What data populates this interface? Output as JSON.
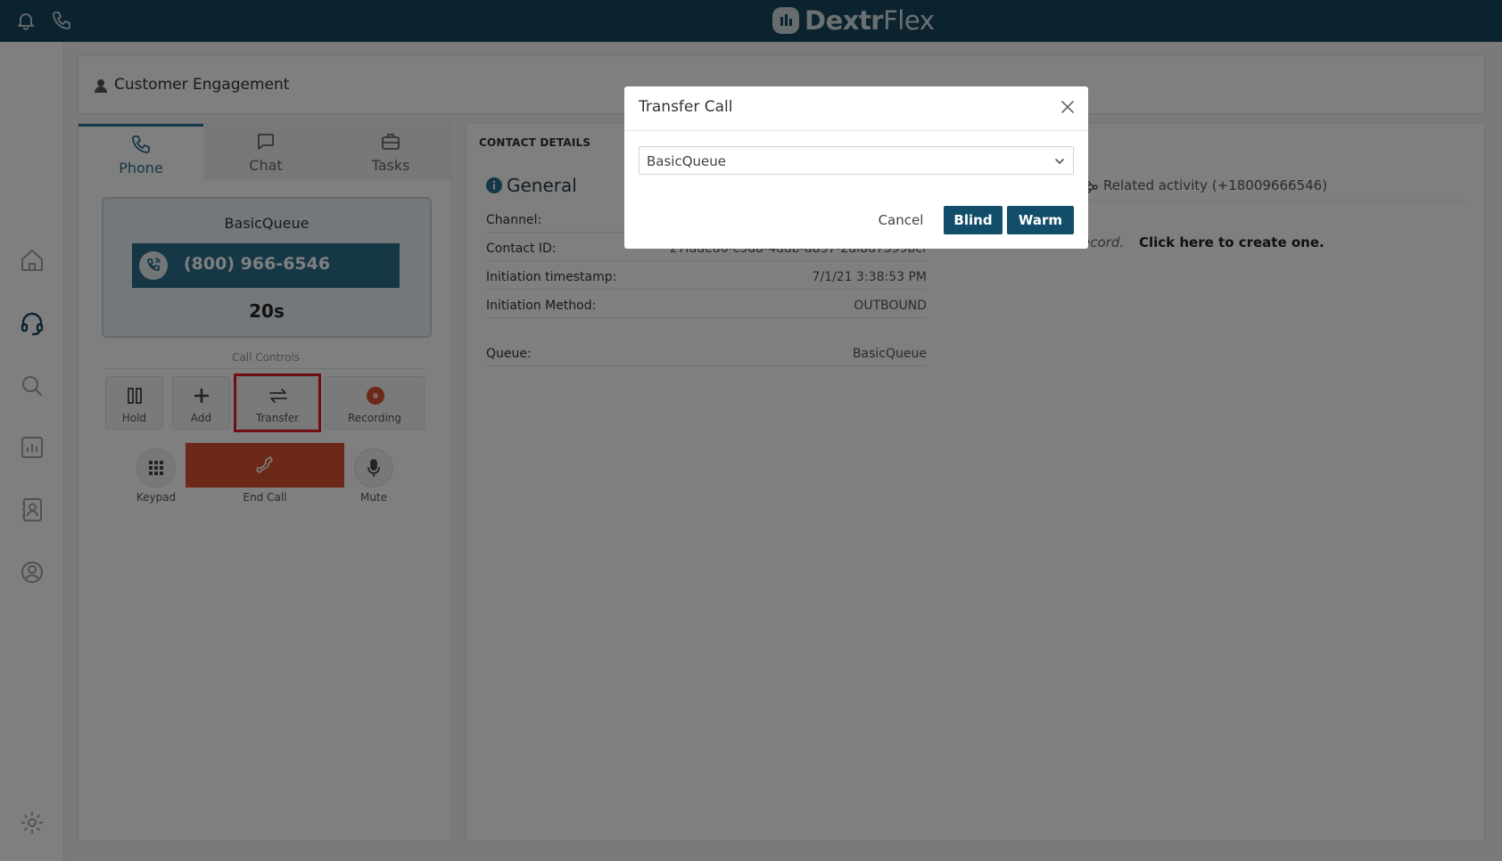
{
  "app": {
    "brand_left": "Dextr",
    "brand_right": "Flex"
  },
  "topbar": {
    "icons": [
      "bell-icon",
      "phone-icon"
    ]
  },
  "sidebar": {
    "icons": [
      "home-icon",
      "headset-icon",
      "search-icon",
      "chart-icon",
      "contacts-icon",
      "user-circle-icon",
      "gear-icon"
    ]
  },
  "header": {
    "title": "Customer Engagement"
  },
  "tabs": [
    {
      "label": "Phone",
      "icon": "phone-icon",
      "active": true
    },
    {
      "label": "Chat",
      "icon": "chat-icon",
      "active": false
    },
    {
      "label": "Tasks",
      "icon": "briefcase-icon",
      "active": false
    }
  ],
  "call": {
    "queue": "BasicQueue",
    "number": "(800) 966-6546",
    "duration": "20s"
  },
  "call_controls": {
    "label": "Call Controls",
    "hold": "Hold",
    "add": "Add",
    "transfer": "Transfer",
    "recording": "Recording",
    "keypad": "Keypad",
    "end_call": "End Call",
    "mute": "Mute"
  },
  "contact_details": {
    "title": "CONTACT DETAILS",
    "section": "General",
    "rows": [
      {
        "label": "Channel:",
        "value": ""
      },
      {
        "label": "Contact ID:",
        "value": "27ldded6-c5d8-4ddb-d837-2dl8d7399bcf"
      },
      {
        "label": "Initiation timestamp:",
        "value": "7/1/21 3:38:53 PM"
      },
      {
        "label": "Initiation Method:",
        "value": "OUTBOUND"
      },
      {
        "label": "Queue:",
        "value": "BasicQueue"
      }
    ],
    "related_activity": "Related activity (+18009666546)",
    "record_note": "ecord.",
    "create_link": "Click here to create one."
  },
  "modal": {
    "title": "Transfer Call",
    "select_value": "BasicQueue",
    "cancel": "Cancel",
    "blind": "Blind",
    "warm": "Warm"
  },
  "colors": {
    "topbar": "#17475e",
    "accent": "#2b6e8c",
    "end_call": "#d9532f",
    "primary_button": "#124e6a",
    "highlight": "#e31c23"
  }
}
